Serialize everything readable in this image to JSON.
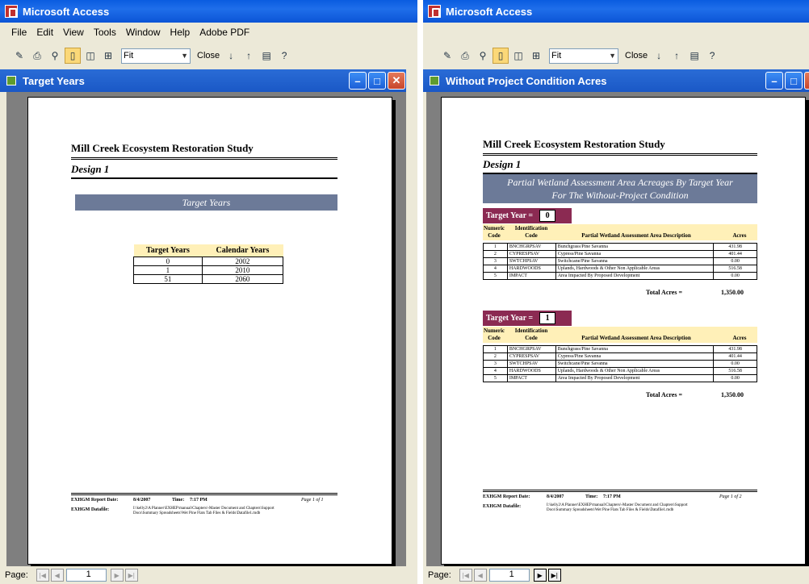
{
  "app": {
    "title": "Microsoft Access"
  },
  "menu": [
    "File",
    "Edit",
    "View",
    "Tools",
    "Window",
    "Help",
    "Adobe PDF"
  ],
  "toolbar": {
    "zoom": "Fit",
    "close_label": "Close"
  },
  "left": {
    "window_title": "Target Years",
    "report": {
      "title": "Mill Creek Ecosystem Restoration Study",
      "subtitle": "Design 1",
      "band": "Target Years",
      "table": {
        "headers": [
          "Target Years",
          "Calendar Years"
        ],
        "rows": [
          [
            "0",
            "2002"
          ],
          [
            "1",
            "2010"
          ],
          [
            "51",
            "2060"
          ]
        ]
      },
      "footer": {
        "date_label": "EXHGM Report Date:",
        "date": "8/4/2007",
        "time_label": "Time:",
        "time": "7:17 PM",
        "page": "Page 1 of 1",
        "datafile_label": "EXHGM Datafile:",
        "datafile_line1": "I:\\kelly2\\A Planner\\EXHEP\\manual\\Chapters\\-Master Document and Chapters\\Support",
        "datafile_line2": "Docs\\Summary Spreadsheets\\Wet Pine Flats Tab Files & Fields\\Datafile1.mdb"
      }
    },
    "status": {
      "label": "Page:",
      "page": "1"
    }
  },
  "right": {
    "window_title": "Without Project Condition Acres",
    "report": {
      "title": "Mill Creek Ecosystem Restoration Study",
      "subtitle": "Design 1",
      "band_line1": "Partial Wetland Assessment Area Acreages By Target Year",
      "band_line2": "For The Without-Project Condition",
      "ty_label": "Target Year =",
      "col_headers": {
        "num_a": "Numeric",
        "num_b": "Code",
        "id_a": "Identification",
        "id_b": "Code",
        "desc": "Partial Wetland Assessment Area Description",
        "acres": "Acres"
      },
      "groups": [
        {
          "year": "0",
          "rows": [
            [
              "1",
              "BNCHGRPSAV",
              "Bunchgrass/Pine Savanna",
              "431.98"
            ],
            [
              "2",
              "CYPRESPSAV",
              "Cypress/Pine Savanna",
              "401.44"
            ],
            [
              "3",
              "SWTCHPSAV",
              "Switchcane/Pine Savanna",
              "0.00"
            ],
            [
              "4",
              "HARDWOODS",
              "Uplands, Hardwoods & Other Non Applicable Areas",
              "516.58"
            ],
            [
              "5",
              "IMPACT",
              "Area Impacted By Proposed Development",
              "0.00"
            ]
          ],
          "total_label": "Total Acres =",
          "total": "1,350.00"
        },
        {
          "year": "1",
          "rows": [
            [
              "1",
              "BNCHGRPSAV",
              "Bunchgrass/Pine Savanna",
              "431.98"
            ],
            [
              "2",
              "CYPRESPSAV",
              "Cypress/Pine Savanna",
              "401.44"
            ],
            [
              "3",
              "SWTCHPSAV",
              "Switchcane/Pine Savanna",
              "0.00"
            ],
            [
              "4",
              "HARDWOODS",
              "Uplands, Hardwoods & Other Non Applicable Areas",
              "516.58"
            ],
            [
              "5",
              "IMPACT",
              "Area Impacted By Proposed Development",
              "0.00"
            ]
          ],
          "total_label": "Total Acres =",
          "total": "1,350.00"
        }
      ],
      "footer": {
        "date_label": "EXHGM Report Date:",
        "date": "8/4/2007",
        "time_label": "Time:",
        "time": "7:17 PM",
        "page": "Page 1 of 2",
        "datafile_label": "EXHGM Datafile:",
        "datafile_line1": "I:\\kelly2\\A Planner\\EXHEP\\manual\\Chapters\\-Master Document and Chapters\\Support",
        "datafile_line2": "Docs\\Summary Spreadsheets\\Wet Pine Flats Tab Files & Fields\\Datafile1.mdb"
      }
    },
    "status": {
      "label": "Page:",
      "page": "1"
    }
  }
}
